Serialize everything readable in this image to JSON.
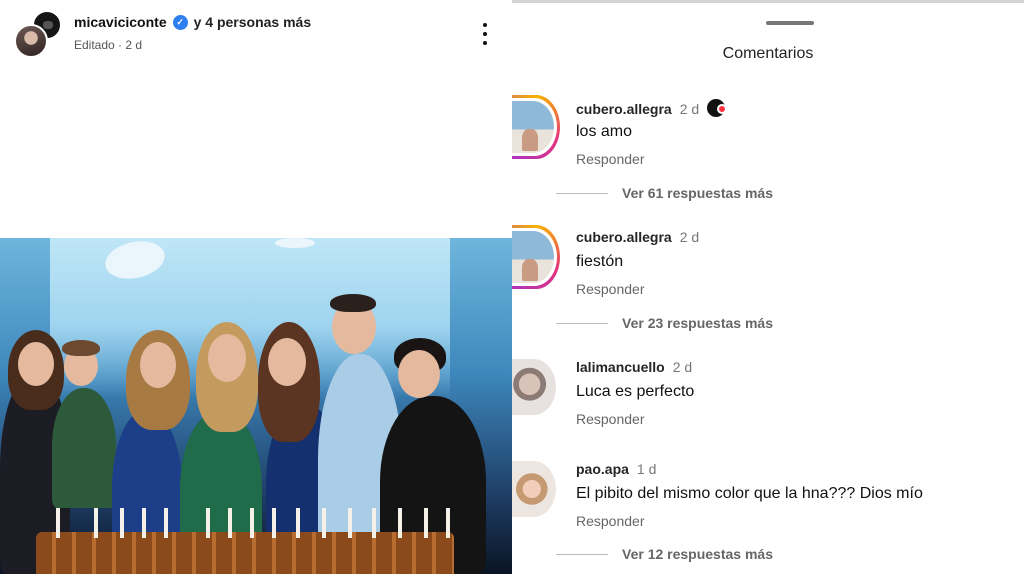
{
  "post": {
    "author": "micaviciconte",
    "collab_suffix": "y 4 personas más",
    "edited": "Editado · 2 d",
    "icons": {
      "verified": "verified-badge-icon",
      "more": "more-options-icon"
    }
  },
  "comments_panel": {
    "title": "Comentarios",
    "comments": [
      {
        "user": "cubero.allegra",
        "time": "2 d",
        "text": "los amo",
        "reply_label": "Responder",
        "more_replies": "Ver 61 respuestas más"
      },
      {
        "user": "cubero.allegra",
        "time": "2 d",
        "text": "fiestón",
        "reply_label": "Responder",
        "more_replies": "Ver 23 respuestas más"
      },
      {
        "user": "lalimancuello",
        "time": "2 d",
        "text": "Luca es perfecto",
        "reply_label": "Responder"
      },
      {
        "user": "pao.apa",
        "time": "1 d",
        "text": "El pibito del mismo color que la hna??? Dios mío",
        "reply_label": "Responder",
        "more_replies": "Ver 12 respuestas más"
      }
    ]
  },
  "colors": {
    "verified": "#2f7ff0",
    "story_ring": "#e5337a",
    "like_heart": "#ff3040"
  }
}
